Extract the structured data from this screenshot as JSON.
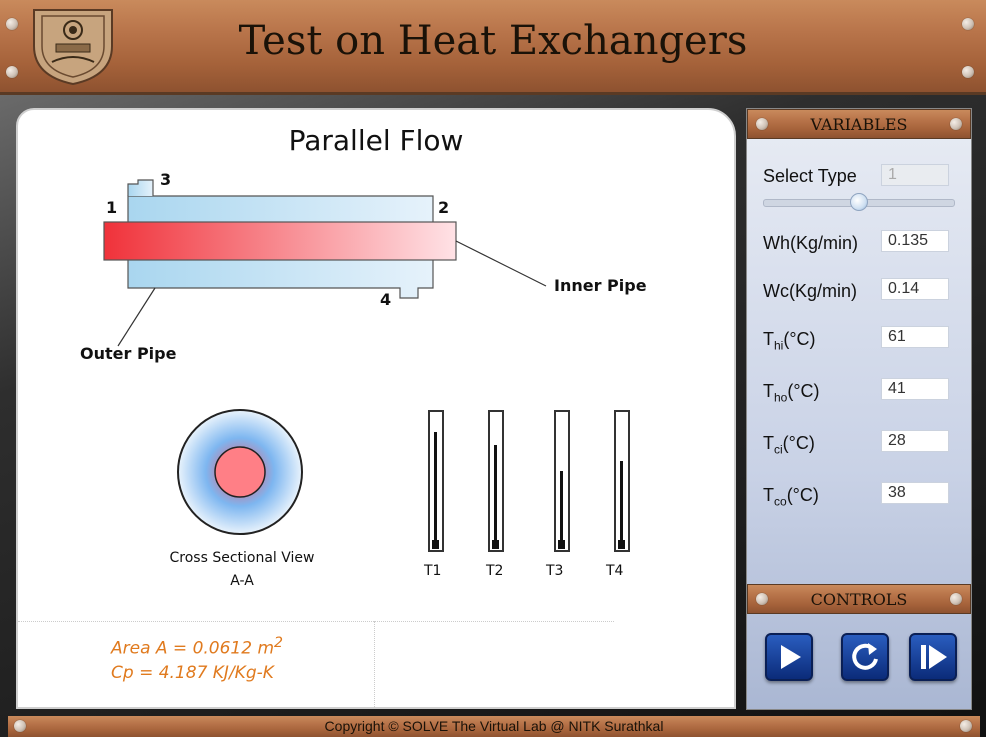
{
  "header": {
    "title": "Test on Heat Exchangers"
  },
  "diagram": {
    "title": "Parallel Flow",
    "point_labels": [
      "1",
      "2",
      "3",
      "4"
    ],
    "inner_pipe_label": "Inner Pipe",
    "outer_pipe_label": "Outer Pipe",
    "cross_section_label_1": "Cross Sectional View",
    "cross_section_label_2": "A-A",
    "thermometers": [
      {
        "label": "T1",
        "level": 0.88
      },
      {
        "label": "T2",
        "level": 0.78
      },
      {
        "label": "T3",
        "level": 0.58
      },
      {
        "label": "T4",
        "level": 0.65
      }
    ]
  },
  "info": {
    "area_prefix": "Area A = 0.0612 m",
    "area_sup": "2",
    "cp": "Cp = 4.187 KJ/Kg-K"
  },
  "variables": {
    "heading": "VARIABLES",
    "select_type_label": "Select Type",
    "select_type_value": "1",
    "slider_fraction": 0.5,
    "wh_label": "Wh(Kg/min)",
    "wh_value": "0.135",
    "wc_label": "Wc(Kg/min)",
    "wc_value": "0.14",
    "thi": {
      "main": "T",
      "sub": "hi",
      "unit": "(°C)",
      "value": "61"
    },
    "tho": {
      "main": "T",
      "sub": "ho",
      "unit": "(°C)",
      "value": "41"
    },
    "tci": {
      "main": "T",
      "sub": "ci",
      "unit": "(°C)",
      "value": "28"
    },
    "tco": {
      "main": "T",
      "sub": "co",
      "unit": "(°C)",
      "value": "38"
    }
  },
  "controls": {
    "heading": "CONTROLS",
    "buttons": [
      "play-icon",
      "reset-icon",
      "step-forward-icon"
    ]
  },
  "footer": {
    "copyright": "Copyright © SOLVE The Virtual Lab @ NITK Surathkal"
  }
}
